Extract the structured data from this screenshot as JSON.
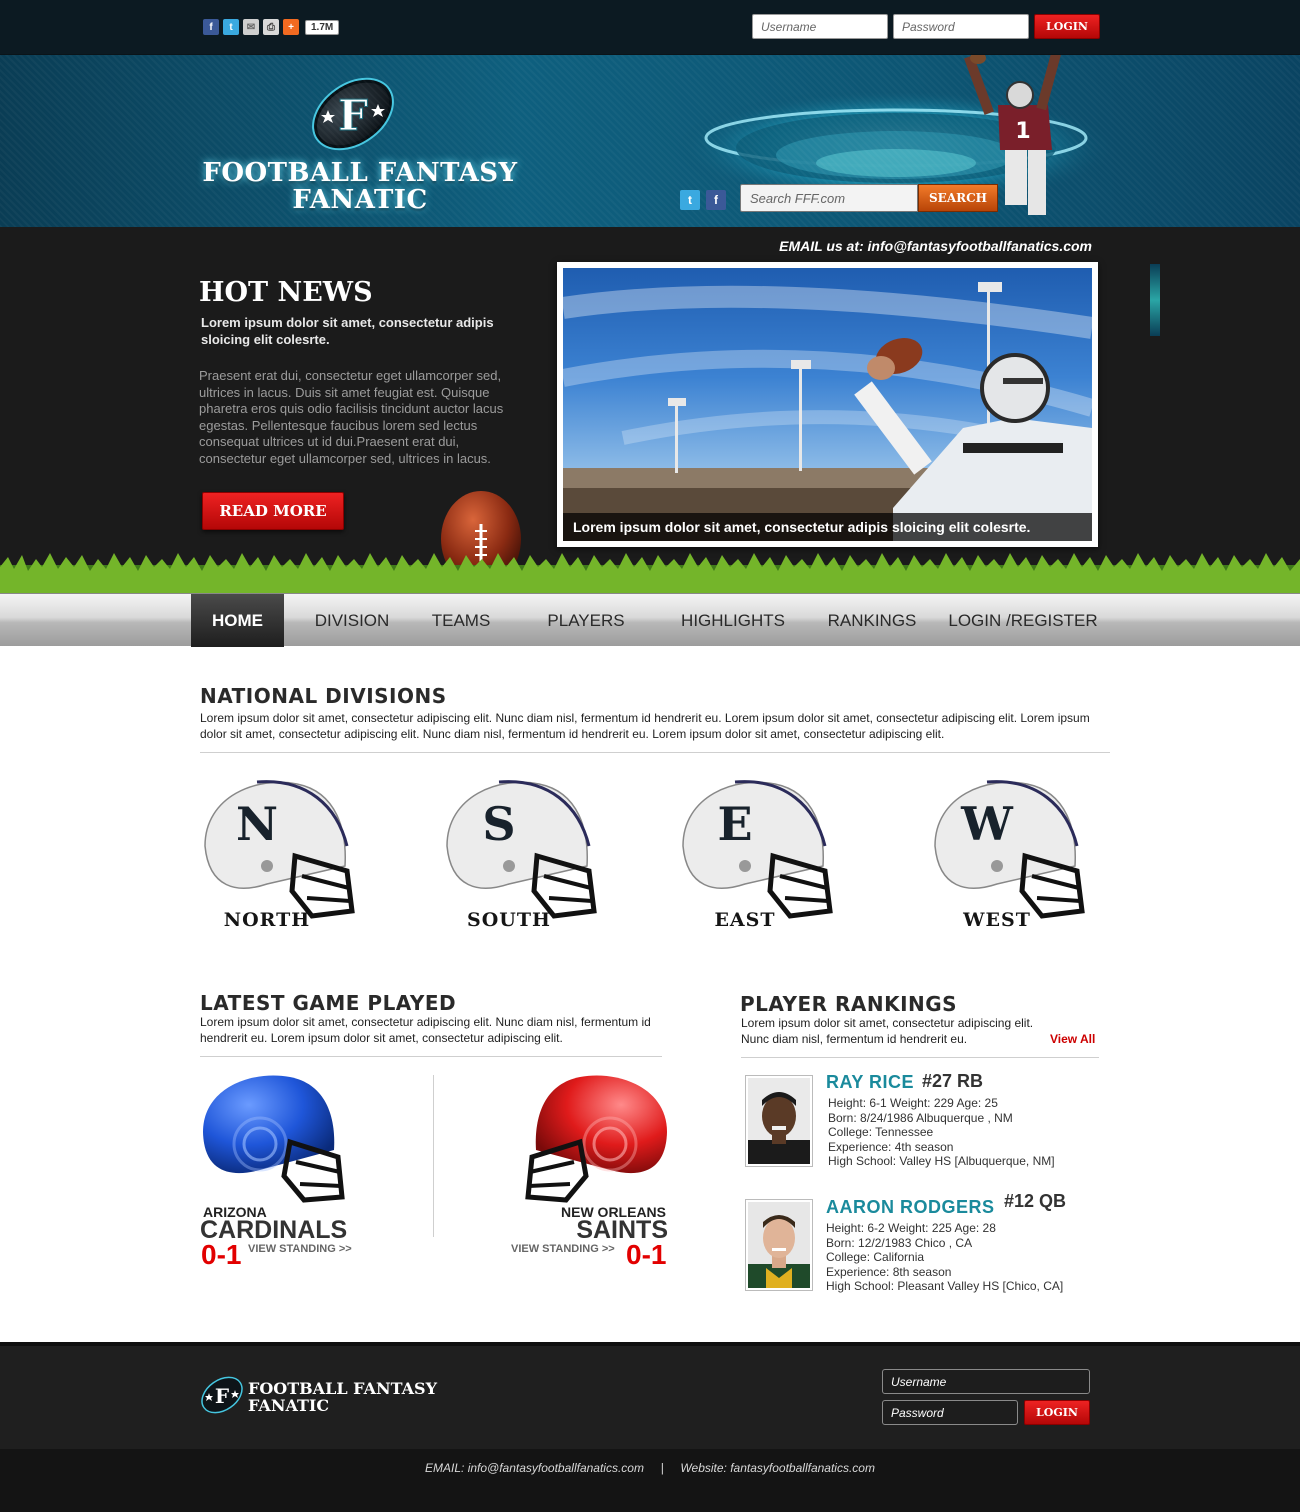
{
  "topbar": {
    "share_count": "1.7M",
    "username_placeholder": "Username",
    "password_placeholder": "Password",
    "login_label": "LOGIN"
  },
  "header": {
    "logo_line1": "FOOTBALL FANTASY",
    "logo_line2": "FANATIC",
    "logo_letter": "F",
    "search_placeholder": "Search FFF.com",
    "search_label": "SEARCH"
  },
  "hot_news": {
    "email": "EMAIL us at: info@fantasyfootballfanatics.com",
    "title": "HOT NEWS",
    "subtitle": "Lorem ipsum dolor sit amet, consectetur adipis sloicing elit colesrte.",
    "body": "Praesent erat dui, consectetur eget ullamcorper sed, ultrices in lacus. Duis sit amet feugiat est. Quisque pharetra eros quis odio facilisis tincidunt auctor lacus egestas. Pellentesque faucibus lorem sed lectus consequat ultrices ut id dui.Praesent erat dui, consectetur eget ullamcorper sed, ultrices in lacus.",
    "read_more": "READ MORE",
    "caption": "Lorem ipsum dolor sit amet, consectetur adipis sloicing elit colesrte."
  },
  "nav": {
    "items": [
      "HOME",
      "DIVISION",
      "TEAMS",
      "PLAYERS",
      "HIGHLIGHTS",
      "RANKINGS",
      "LOGIN /REGISTER"
    ],
    "active": "HOME"
  },
  "divisions": {
    "title": "NATIONAL DIVISIONS",
    "text": "Lorem ipsum dolor sit amet, consectetur adipiscing elit. Nunc diam nisl, fermentum id hendrerit eu. Lorem ipsum dolor sit amet, consectetur adipiscing elit. Lorem ipsum dolor sit amet, consectetur adipiscing elit. Nunc diam nisl, fermentum id hendrerit eu. Lorem ipsum dolor sit amet, consectetur adipiscing elit.",
    "items": [
      {
        "letter": "N",
        "name": "NORTH"
      },
      {
        "letter": "S",
        "name": "SOUTH"
      },
      {
        "letter": "E",
        "name": "EAST"
      },
      {
        "letter": "W",
        "name": "WEST"
      }
    ]
  },
  "latest_game": {
    "title": "LATEST GAME PLAYED",
    "text": "Lorem ipsum dolor sit amet, consectetur adipiscing elit. Nunc diam nisl, fermentum id hendrerit eu. Lorem ipsum dolor sit amet, consectetur adipiscing elit.",
    "home": {
      "city": "ARIZONA",
      "name": "CARDINALS",
      "score": "0-1",
      "link": "VIEW STANDING >>",
      "helmet_color": "#1f56d9"
    },
    "away": {
      "city": "NEW ORLEANS",
      "name": "SAINTS",
      "score": "0-1",
      "link": "VIEW STANDING >>",
      "helmet_color": "#e01b1b"
    }
  },
  "rankings": {
    "title": "PLAYER RANKINGS",
    "text": "Lorem ipsum dolor sit amet, consectetur adipiscing elit. Nunc diam nisl, fermentum id hendrerit eu.",
    "view_all": "View All",
    "players": [
      {
        "name": "RAY RICE",
        "number": "#27 RB",
        "line1": "Height: 6-1   Weight: 229   Age: 25",
        "line2": "Born: 8/24/1986 Albuquerque , NM",
        "line3": "College: Tennessee",
        "line4": "Experience: 4th season",
        "line5": "High School: Valley HS [Albuquerque, NM]"
      },
      {
        "name": "AARON RODGERS",
        "number": "#12 QB",
        "line1": "Height: 6-2   Weight: 225   Age: 28",
        "line2": "Born: 12/2/1983 Chico , CA",
        "line3": "College: California",
        "line4": "Experience: 8th season",
        "line5": "High School: Pleasant Valley HS [Chico, CA]"
      }
    ]
  },
  "footer": {
    "logo_line1": "FOOTBALL FANTASY",
    "logo_line2": "FANATIC",
    "username_placeholder": "Username",
    "password_placeholder": "Password",
    "login_label": "LOGIN",
    "bottom_text": "EMAIL: info@fantasyfootballfanatics.com     |     Website: fantasyfootballfanatics.com"
  },
  "colors": {
    "accent_red": "#e20000",
    "player_name": "#1a8a9c",
    "header_teal": "#0e5f7e",
    "search_orange": "#e0641a"
  }
}
